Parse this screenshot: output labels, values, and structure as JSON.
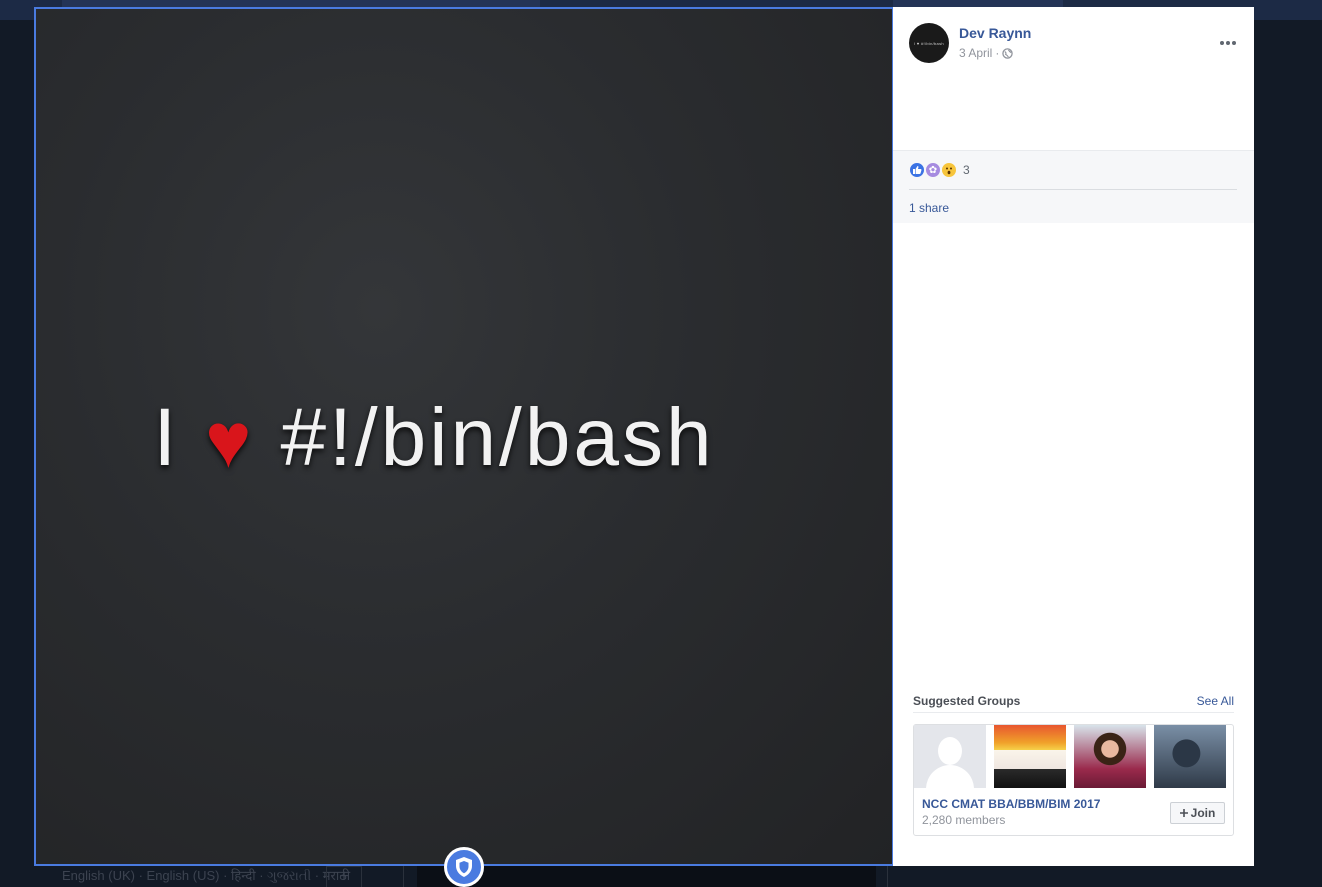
{
  "background": {
    "bottom_text": "English (UK) · English (US) · हिन्दी · ગુજરાતી · मराठी",
    "plus_label": "+"
  },
  "photo": {
    "text_before": "I",
    "heart": "♥",
    "text_after": "#!/bin/bash",
    "shield_icon": "shield-icon",
    "accent": "#4a7be0"
  },
  "post": {
    "author": "Dev Raynn",
    "avatar_text": "I ♥ #!/bin/bash",
    "date": "3 April",
    "separator": "·",
    "privacy_icon": "globe-icon",
    "more_icon": "more-icon"
  },
  "reactions": {
    "icons": [
      "like-icon",
      "flower-icon",
      "wow-icon"
    ],
    "count": "3",
    "shares": "1 share"
  },
  "suggested_groups": {
    "title": "Suggested Groups",
    "see_all": "See All",
    "group": {
      "name": "NCC CMAT BBA/BBM/BIM 2017",
      "members": "2,280 members",
      "join_label": "Join",
      "join_icon": "plus-icon"
    }
  },
  "colors": {
    "link": "#385898",
    "muted": "#90949c",
    "panel_bg": "#ffffff"
  }
}
